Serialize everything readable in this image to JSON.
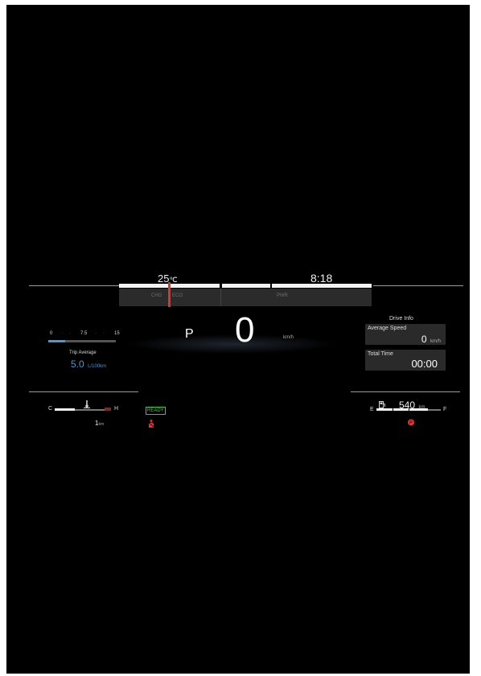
{
  "header": {
    "temperature": "25",
    "temperature_unit": "℃",
    "clock": "8:18"
  },
  "power_meter": {
    "chg_label": "CHG",
    "eco_label": "ECO",
    "pwr_label": "PWR",
    "needle_color": "#e0322c"
  },
  "gear": "P",
  "speed": {
    "value": "0",
    "unit": "km/h"
  },
  "fuel_economy": {
    "scale": [
      "0",
      "7.5",
      "15"
    ],
    "title": "Trip Average",
    "value": "5.0",
    "unit": "L/100km",
    "bar_fraction": 0.25,
    "accent_color": "#4f96d8"
  },
  "drive_info": {
    "title": "Drive Info",
    "average_speed": {
      "label": "Average Speed",
      "value": "0",
      "unit": "km/h"
    },
    "total_time": {
      "label": "Total Time",
      "value": "00:00"
    }
  },
  "coolant": {
    "cold": "C",
    "hot": "H",
    "icon": "coolant-thermometer-icon",
    "level_fraction": 0.35
  },
  "odometer": {
    "value": "1",
    "unit": "km"
  },
  "ready_label": "READY",
  "ready_color": "#4cc24c",
  "warning_color": "#d7382f",
  "fuel": {
    "empty": "E",
    "full": "F",
    "range": "540",
    "range_unit": "km",
    "icon": "fuel-pump-icon",
    "level_fraction": 0.8
  },
  "parking_brake_icon": "parking-brake-icon"
}
